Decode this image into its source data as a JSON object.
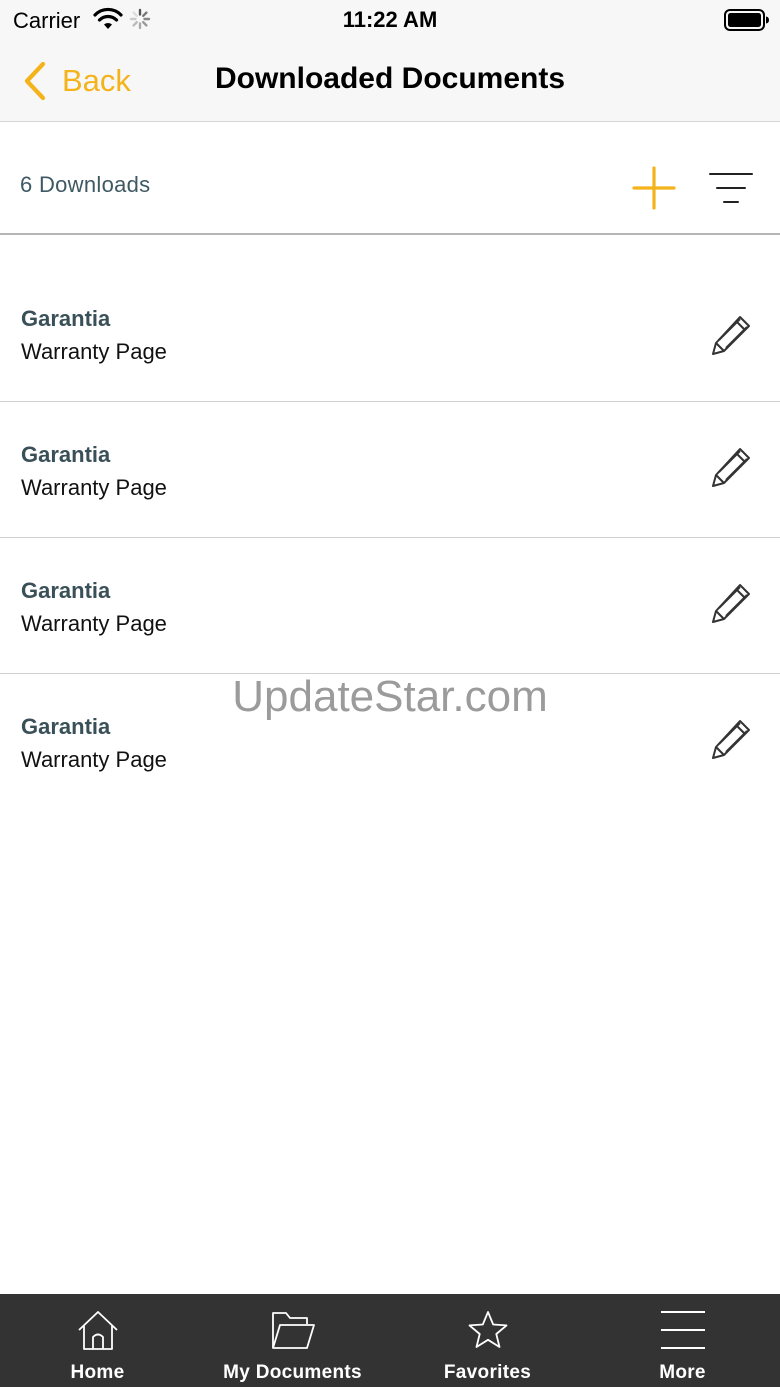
{
  "status_bar": {
    "carrier": "Carrier",
    "time": "11:22 AM"
  },
  "nav": {
    "back_label": "Back",
    "title": "Downloaded Documents"
  },
  "toolbar": {
    "count_label": "6 Downloads"
  },
  "documents": [
    {
      "title": "Garantia",
      "subtitle": "Warranty Page"
    },
    {
      "title": "Garantia",
      "subtitle": "Warranty Page"
    },
    {
      "title": "Garantia",
      "subtitle": "Warranty Page"
    },
    {
      "title": "Garantia",
      "subtitle": "Warranty Page"
    }
  ],
  "watermark": "UpdateStar.com",
  "tabs": [
    {
      "label": "Home",
      "icon": "home-icon"
    },
    {
      "label": "My Documents",
      "icon": "folder-icon"
    },
    {
      "label": "Favorites",
      "icon": "star-icon"
    },
    {
      "label": "More",
      "icon": "menu-icon"
    }
  ],
  "colors": {
    "accent": "#f4b31b",
    "tab_bar": "#333333",
    "doc_title": "#3a5059",
    "count_text": "#3e5963"
  }
}
